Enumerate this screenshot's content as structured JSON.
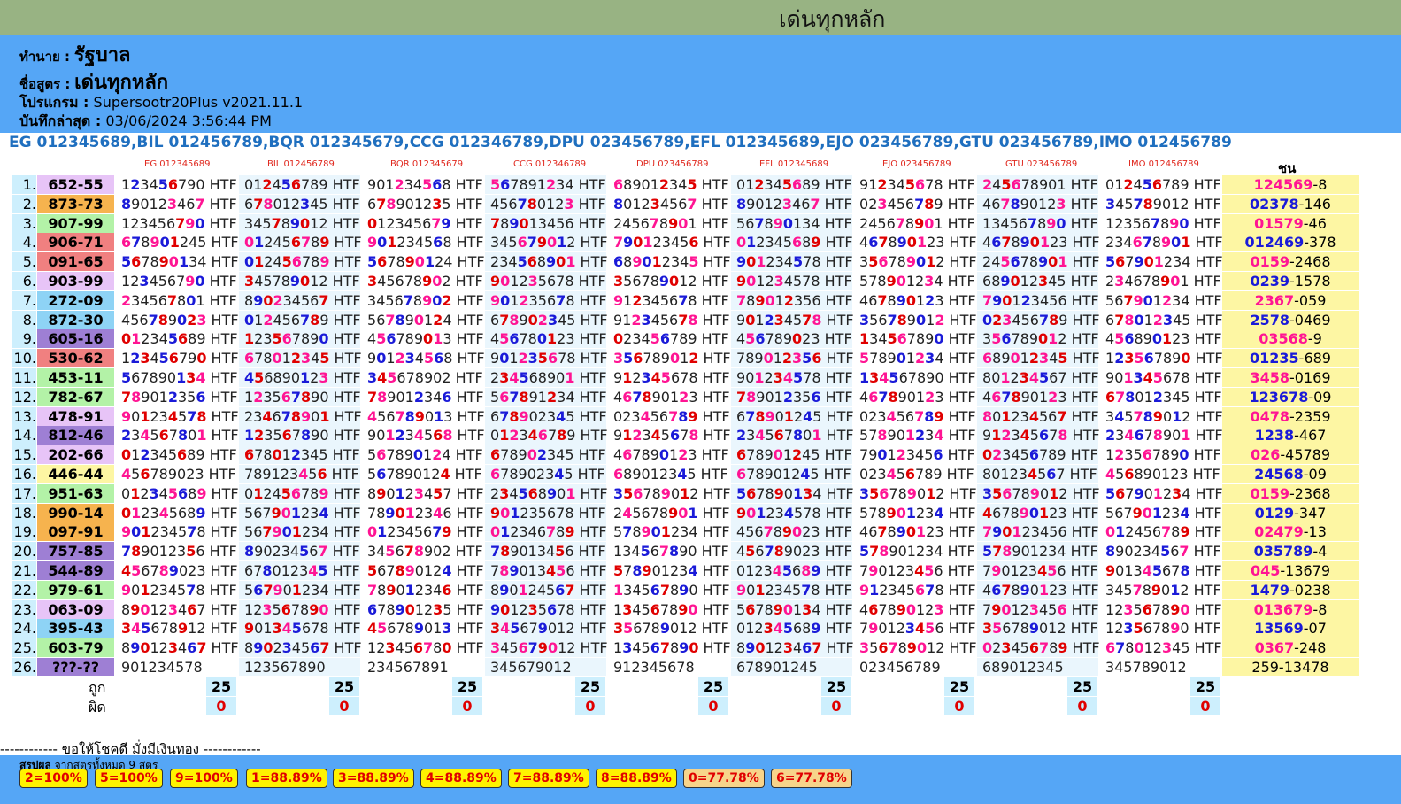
{
  "header": {
    "title": "เด่นทุกหลัก"
  },
  "info": {
    "predict_label": "ทำนาย :",
    "predict_value": "รัฐบาล",
    "formula_label": "ชื่อสูตร :",
    "formula_value": "เด่นทุกหลัก",
    "program_label": "โปรแกรม :",
    "program_value": "Supersootr20Plus v2021.11.1",
    "saved_label": "บันทึกล่าสุด :",
    "saved_value": "03/06/2024 3:56:44 PM"
  },
  "formulas": [
    "EG 012345689",
    "BIL 012456789",
    "BQR 012345679",
    "CCG 012346789",
    "DPU 023456789",
    "EFL 012345689",
    "EJO 023456789",
    "GTU 023456789",
    "IMO 012456789"
  ],
  "columns": [
    "EG 012345689",
    "BIL 012456789",
    "BQR 012345679",
    "CCG 012346789",
    "DPU 023456789",
    "EFL 012345689",
    "EJO 023456789",
    "GTU 023456789",
    "IMO 012456789"
  ],
  "chon_label": "ชน",
  "suffix": "HTF",
  "colors": {
    "hit_pink": "#ff1493",
    "hit_blue": "#1a1ad8",
    "hit_red": "#e00000"
  },
  "rows": [
    {
      "n": "1.",
      "r": "652-55",
      "bg": "#e7c4f7",
      "cells": [
        "1234567|90",
        "0124567|89",
        "9012345|68",
        "5678912|34",
        "6890123|45",
        "0123456|89",
        "9123456|78",
        "2456789|01",
        "0124567|89"
      ],
      "ch": "124569-8"
    },
    {
      "n": "2.",
      "r": "873-73",
      "bg": "#f6b34e",
      "cells": [
        "8901234|67",
        "6780123|45",
        "6789012|35",
        "4567801|23",
        "8012345|67",
        "8901234|67",
        "0234567|89",
        "4678901|23",
        "3457890|12"
      ],
      "ch": "02378-146"
    },
    {
      "n": "3.",
      "r": "907-99",
      "bg": "#b3f2a7",
      "cells": [
        "1234567|90",
        "3457890|12",
        "0123456|79",
        "7890134|56",
        "2456789|01",
        "5678901|34",
        "2456789|01",
        "1345678|90",
        "1235678|90"
      ],
      "ch": "01579-46"
    },
    {
      "n": "4.",
      "r": "906-71",
      "bg": "#f08080",
      "cells": [
        "6789012|45",
        "0124567|89",
        "9012345|68",
        "3456790|12",
        "7901234|56",
        "0123456|89",
        "4678901|23",
        "4678901|23",
        "2346789|01"
      ],
      "ch": "012469-378"
    },
    {
      "n": "5.",
      "r": "091-65",
      "bg": "#f08080",
      "cells": [
        "5678901|34",
        "0124567|89",
        "5678901|24",
        "2345689|01",
        "6890123|45",
        "9012345|78",
        "3567890|12",
        "2456789|01",
        "5679012|34"
      ],
      "ch": "0159-2468"
    },
    {
      "n": "6.",
      "r": "903-99",
      "bg": "#e7c4f7",
      "cells": [
        "1234567|90",
        "3457890|12",
        "3456789|02",
        "9012356|78",
        "3567890|12",
        "9012345|78",
        "5789012|34",
        "6890123|45",
        "2346789|01"
      ],
      "ch": "0239-1578"
    },
    {
      "n": "7.",
      "r": "272-09",
      "bg": "#8ed3f5",
      "cells": [
        "2345678|01",
        "8902345|67",
        "3456789|02",
        "9012356|78",
        "9123456|78",
        "7890123|56",
        "4678901|23",
        "7901234|56",
        "5679012|34"
      ],
      "ch": "2367-059"
    },
    {
      "n": "8.",
      "r": "872-30",
      "bg": "#8ed3f5",
      "cells": [
        "4567890|23",
        "0124567|89",
        "5678901|24",
        "6789023|45",
        "9123456|78",
        "9012345|78",
        "3567890|12",
        "0234567|89",
        "6780123|45"
      ],
      "ch": "2578-0469"
    },
    {
      "n": "9.",
      "r": "605-16",
      "bg": "#9e7fd4",
      "cells": [
        "0123456|89",
        "1235678|90",
        "4567890|13",
        "4567801|23",
        "0234567|89",
        "4567890|23",
        "1345678|90",
        "3567890|12",
        "4568901|23"
      ],
      "ch": "03568-9"
    },
    {
      "n": "10.",
      "r": "530-62",
      "bg": "#f08080",
      "cells": [
        "1234567|90",
        "6780123|45",
        "9012345|68",
        "9012356|78",
        "3567890|12",
        "7890123|56",
        "5789012|34",
        "6890123|45",
        "1235678|90"
      ],
      "ch": "01235-689"
    },
    {
      "n": "11.",
      "r": "453-11",
      "bg": "#b3f2a7",
      "cells": [
        "5678901|34",
        "4568901|23",
        "3456789|02",
        "2345689|01",
        "9123456|78",
        "9012345|78",
        "1345678|90",
        "8012345|67",
        "9013456|78"
      ],
      "ch": "3458-0169"
    },
    {
      "n": "12.",
      "r": "782-67",
      "bg": "#b3f2a7",
      "cells": [
        "7890123|56",
        "1235678|90",
        "7890123|46",
        "5678912|34",
        "4678901|23",
        "7890123|56",
        "4678901|23",
        "4678901|23",
        "6780123|45"
      ],
      "ch": "123678-09"
    },
    {
      "n": "13.",
      "r": "478-91",
      "bg": "#e7c4f7",
      "cells": [
        "9012345|78",
        "2346789|01",
        "4567890|13",
        "6789023|45",
        "0234567|89",
        "6789012|45",
        "0234567|89",
        "8012345|67",
        "3457890|12"
      ],
      "ch": "0478-2359"
    },
    {
      "n": "14.",
      "r": "812-46",
      "bg": "#9e7fd4",
      "cells": [
        "2345678|01",
        "1235678|90",
        "9012345|68",
        "0123467|89",
        "9123456|78",
        "2345678|01",
        "5789012|34",
        "9123456|78",
        "2346789|01"
      ],
      "ch": "1238-467"
    },
    {
      "n": "15.",
      "r": "202-66",
      "bg": "#e7c4f7",
      "cells": [
        "0123456|89",
        "6780123|45",
        "5678901|24",
        "6789023|45",
        "4678901|23",
        "6789012|45",
        "7901234|56",
        "0234567|89",
        "1235678|90"
      ],
      "ch": "026-45789"
    },
    {
      "n": "16.",
      "r": "446-44",
      "bg": "#fdf6a3",
      "cells": [
        "4567890|23",
        "7891234|56",
        "5678901|24",
        "6789023|45",
        "6890123|45",
        "6789012|45",
        "0234567|89",
        "8012345|67",
        "4568901|23"
      ],
      "ch": "24568-09"
    },
    {
      "n": "17.",
      "r": "951-63",
      "bg": "#b3f2a7",
      "cells": [
        "0123456|89",
        "0124567|89",
        "8901234|57",
        "2345689|01",
        "3567890|12",
        "5678901|34",
        "3567890|12",
        "3567890|12",
        "5679012|34"
      ],
      "ch": "0159-2368"
    },
    {
      "n": "18.",
      "r": "990-14",
      "bg": "#f6b34e",
      "cells": [
        "0123456|89",
        "5679012|34",
        "7890123|46",
        "9012356|78",
        "2456789|01",
        "9012345|78",
        "5789012|34",
        "4678901|23",
        "5679012|34"
      ],
      "ch": "0129-347"
    },
    {
      "n": "19.",
      "r": "097-91",
      "bg": "#f6b34e",
      "cells": [
        "9012345|78",
        "5679012|34",
        "0123456|79",
        "0123467|89",
        "5789012|34",
        "4567890|23",
        "4678901|23",
        "7901234|56",
        "0124567|89"
      ],
      "ch": "02479-13"
    },
    {
      "n": "20.",
      "r": "757-85",
      "bg": "#9e7fd4",
      "cells": [
        "7890123|56",
        "8902345|67",
        "3456789|02",
        "7890134|56",
        "1345678|90",
        "4567890|23",
        "5789012|34",
        "5789012|34",
        "8902345|67"
      ],
      "ch": "035789-4"
    },
    {
      "n": "21.",
      "r": "544-89",
      "bg": "#9e7fd4",
      "cells": [
        "4567890|23",
        "6780123|45",
        "5678901|24",
        "7890134|56",
        "5789012|34",
        "0123456|89",
        "7901234|56",
        "7901234|56",
        "9013456|78"
      ],
      "ch": "045-13679"
    },
    {
      "n": "22.",
      "r": "979-61",
      "bg": "#b3f2a7",
      "cells": [
        "9012345|78",
        "5679012|34",
        "7890123|46",
        "8901245|67",
        "1345678|90",
        "9012345|78",
        "9123456|78",
        "4678901|23",
        "3457890|12"
      ],
      "ch": "1479-0238"
    },
    {
      "n": "23.",
      "r": "063-09",
      "bg": "#e7c4f7",
      "cells": [
        "8901234|67",
        "1235678|90",
        "6789012|35",
        "9012356|78",
        "1345678|90",
        "5678901|34",
        "4678901|23",
        "7901234|56",
        "1235678|90"
      ],
      "ch": "013679-8"
    },
    {
      "n": "24.",
      "r": "395-43",
      "bg": "#8ed3f5",
      "cells": [
        "3456789|12",
        "9013456|78",
        "4567890|13",
        "3456790|12",
        "3567890|12",
        "0123456|89",
        "7901234|56",
        "3567890|12",
        "1235678|90"
      ],
      "ch": "13569-07"
    },
    {
      "n": "25.",
      "r": "603-79",
      "bg": "#b3f2a7",
      "cells": [
        "8901234|67",
        "8902345|67",
        "1234567|80",
        "3456790|12",
        "1345678|90",
        "8901234|67",
        "3567890|12",
        "0234567|89",
        "6780123|45"
      ],
      "ch": "0367-248"
    },
    {
      "n": "26.",
      "r": "???-??",
      "bg": "#9e7fd4",
      "cells": [
        "901234578",
        "123567890",
        "234567891",
        "345679012",
        "912345678",
        "678901245",
        "023456789",
        "689012345",
        "345789012"
      ],
      "ch": "259-13478"
    }
  ],
  "score": {
    "hit_label": "ถูก",
    "miss_label": "ผิด",
    "hits": [
      "25",
      "25",
      "25",
      "25",
      "25",
      "25",
      "25",
      "25",
      "25"
    ],
    "misses": [
      "0",
      "0",
      "0",
      "0",
      "0",
      "0",
      "0",
      "0",
      "0"
    ]
  },
  "footer": {
    "wish": "------------ ขอให้โชคดี มั่งมีเงินทอง ------------",
    "summary_label": "สรุปผล",
    "summary_text": "จากสูตรทั้งหมด 9 สูตร",
    "pills": [
      "2=100%",
      "5=100%",
      "9=100%",
      "1=88.89%",
      "3=88.89%",
      "4=88.89%",
      "7=88.89%",
      "8=88.89%",
      "0=77.78%",
      "6=77.78%"
    ]
  }
}
